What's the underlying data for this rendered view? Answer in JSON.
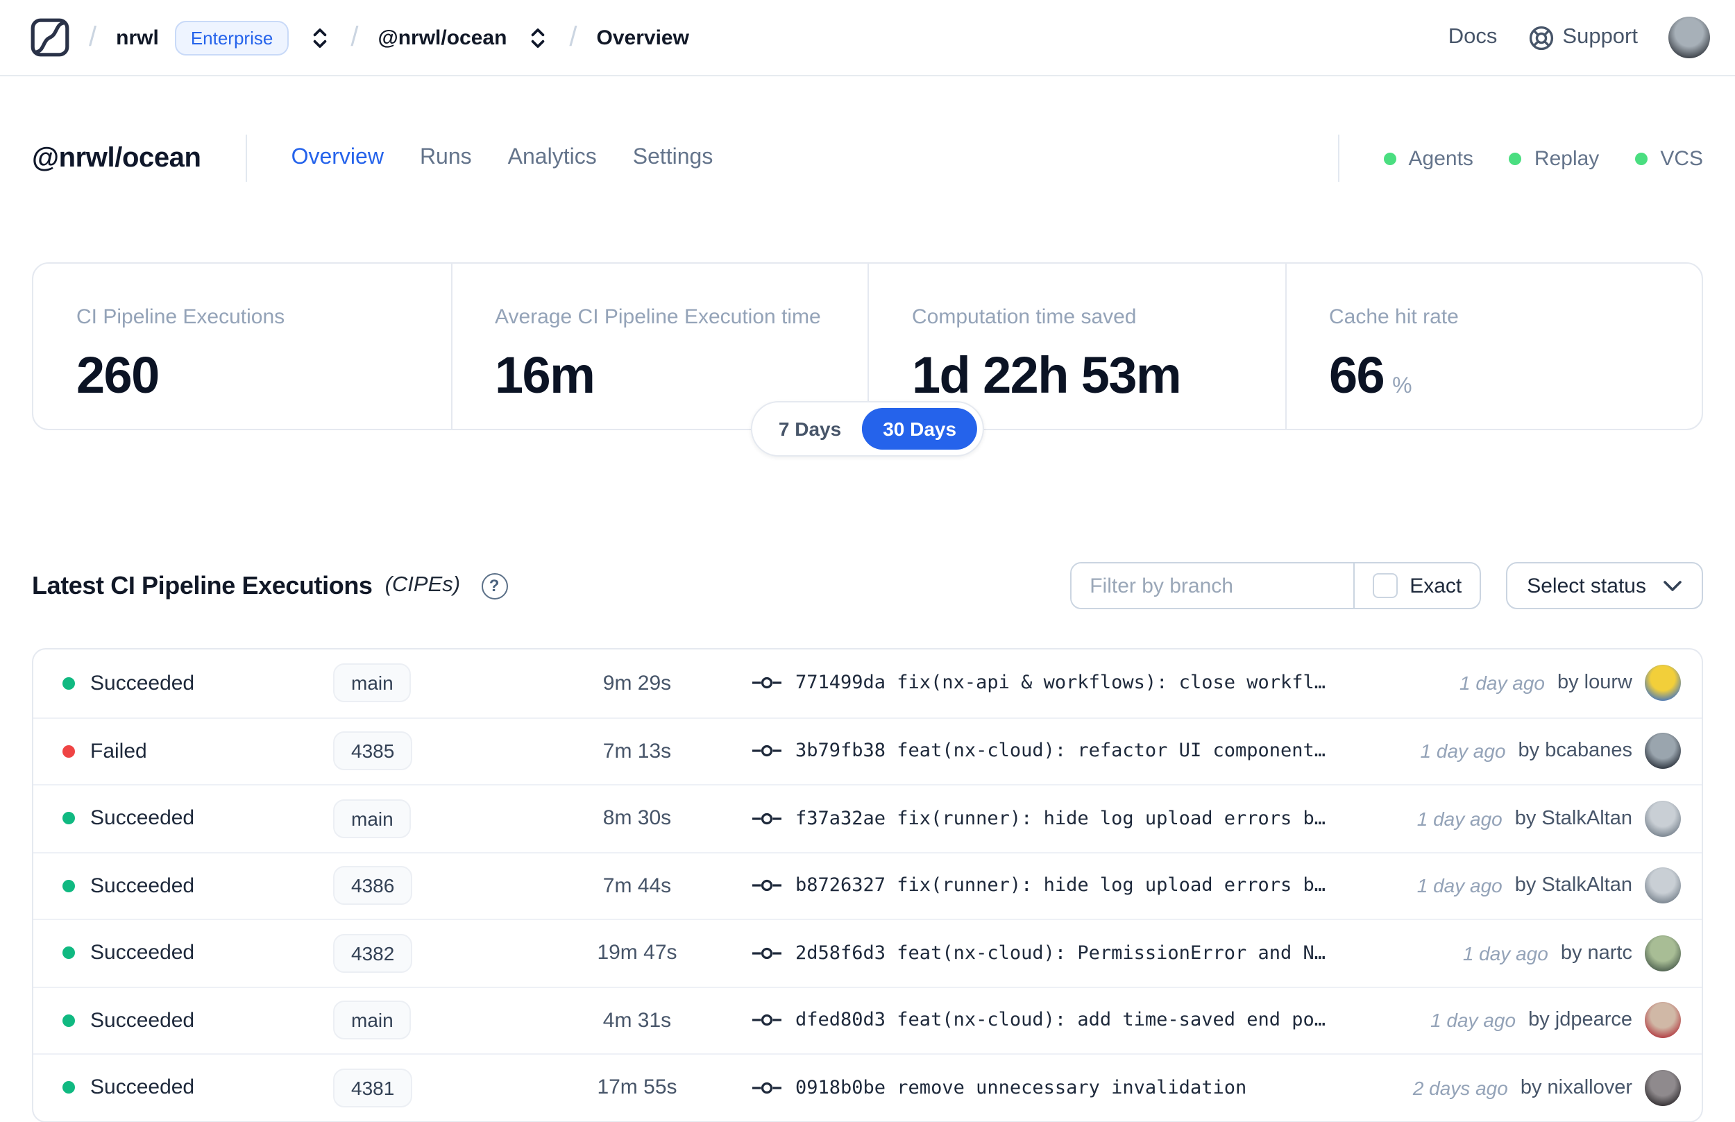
{
  "nav": {
    "breadcrumb": {
      "separator": "/",
      "org": "nrwl",
      "org_badge": "Enterprise",
      "workspace": "@nrwl/ocean",
      "page": "Overview"
    },
    "docs_label": "Docs",
    "support_label": "Support",
    "avatar_colors": [
      "#a7b0b8",
      "#383d44"
    ]
  },
  "header": {
    "title": "@nrwl/ocean",
    "tabs": [
      {
        "label": "Overview",
        "active": true
      },
      {
        "label": "Runs",
        "active": false
      },
      {
        "label": "Analytics",
        "active": false
      },
      {
        "label": "Settings",
        "active": false
      }
    ],
    "indicators": [
      {
        "label": "Agents",
        "color": "#4ade80"
      },
      {
        "label": "Replay",
        "color": "#4ade80"
      },
      {
        "label": "VCS",
        "color": "#4ade80"
      }
    ]
  },
  "stats": [
    {
      "label": "CI Pipeline Executions",
      "value": "260",
      "unit": ""
    },
    {
      "label": "Average CI Pipeline Execution time",
      "value": "16m",
      "unit": ""
    },
    {
      "label": "Computation time saved",
      "value": "1d 22h 53m",
      "unit": ""
    },
    {
      "label": "Cache hit rate",
      "value": "66",
      "unit": "%"
    }
  ],
  "time_toggle": {
    "options": [
      "7 Days",
      "30 Days"
    ],
    "selected": "30 Days",
    "accent_color": "#2563eb"
  },
  "cipe": {
    "title": "Latest CI Pipeline Executions",
    "title_suffix": "(CIPEs)",
    "help_glyph": "?",
    "filter": {
      "placeholder": "Filter by branch",
      "exact_label": "Exact",
      "exact_checked": false
    },
    "status_dropdown_label": "Select status",
    "status_colors": {
      "succeeded": "#10b981",
      "failed": "#ef4444"
    },
    "rows": [
      {
        "status": "Succeeded",
        "status_color": "#10b981",
        "branch": "main",
        "duration": "9m 29s",
        "commit": "771499da fix(nx-api & workflows): close workfl…",
        "time": "1 day ago",
        "author": "by lourw",
        "avatar_colors": [
          "#f2cf3a",
          "#4a78bb"
        ]
      },
      {
        "status": "Failed",
        "status_color": "#ef4444",
        "branch": "4385",
        "duration": "7m 13s",
        "commit": "3b79fb38 feat(nx-cloud): refactor UI component…",
        "time": "1 day ago",
        "author": "by bcabanes",
        "avatar_colors": [
          "#9aa5ae",
          "#2d343e"
        ]
      },
      {
        "status": "Succeeded",
        "status_color": "#10b981",
        "branch": "main",
        "duration": "8m 30s",
        "commit": "f37a32ae fix(runner): hide log upload errors b…",
        "time": "1 day ago",
        "author": "by StalkAltan",
        "avatar_colors": [
          "#c9cfd5",
          "#78838e"
        ]
      },
      {
        "status": "Succeeded",
        "status_color": "#10b981",
        "branch": "4386",
        "duration": "7m 44s",
        "commit": "b8726327 fix(runner): hide log upload errors b…",
        "time": "1 day ago",
        "author": "by StalkAltan",
        "avatar_colors": [
          "#c9cfd5",
          "#78838e"
        ]
      },
      {
        "status": "Succeeded",
        "status_color": "#10b981",
        "branch": "4382",
        "duration": "19m 47s",
        "commit": "2d58f6d3 feat(nx-cloud): PermissionError and N…",
        "time": "1 day ago",
        "author": "by nartc",
        "avatar_colors": [
          "#a8bd95",
          "#4e6150"
        ]
      },
      {
        "status": "Succeeded",
        "status_color": "#10b981",
        "branch": "main",
        "duration": "4m 31s",
        "commit": "dfed80d3 feat(nx-cloud): add time-saved end po…",
        "time": "1 day ago",
        "author": "by jdpearce",
        "avatar_colors": [
          "#d0b8a6",
          "#b23c42"
        ]
      },
      {
        "status": "Succeeded",
        "status_color": "#10b981",
        "branch": "4381",
        "duration": "17m 55s",
        "commit": "0918b0be remove unnecessary invalidation",
        "time": "2 days ago",
        "author": "by nixallover",
        "avatar_colors": [
          "#8f8a8d",
          "#332f32"
        ]
      }
    ]
  }
}
